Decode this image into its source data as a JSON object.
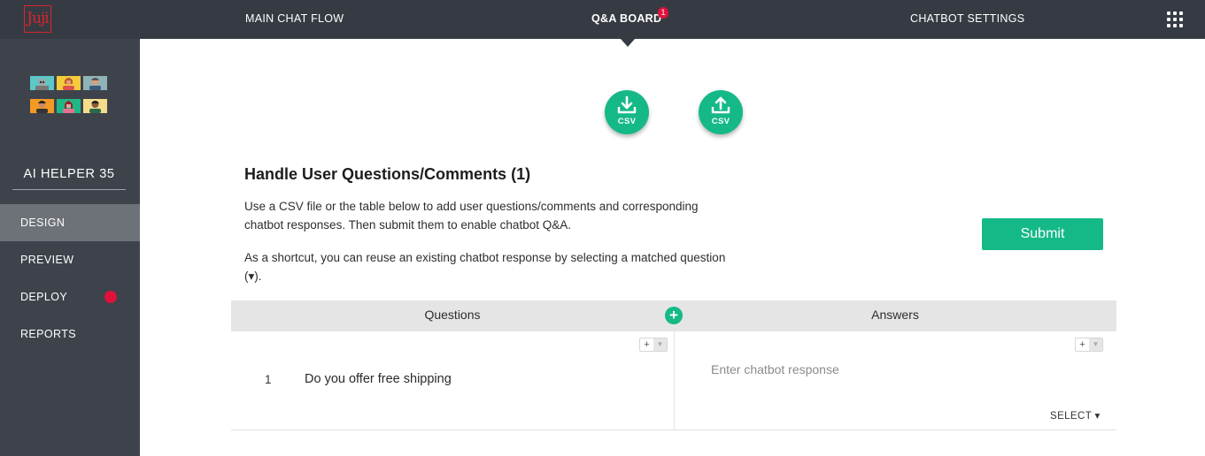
{
  "logo": {
    "text": "Juji"
  },
  "nav": {
    "items": [
      {
        "label": "MAIN CHAT FLOW"
      },
      {
        "label": "Q&A BOARD",
        "badge": "1"
      },
      {
        "label": "CHATBOT SETTINGS"
      }
    ],
    "active": "Q&A BOARD"
  },
  "sidebar": {
    "bot_name": "AI HELPER 35",
    "items": [
      {
        "label": "DESIGN",
        "active": true
      },
      {
        "label": "PREVIEW"
      },
      {
        "label": "DEPLOY",
        "status_dot": "red"
      },
      {
        "label": "REPORTS"
      }
    ]
  },
  "csv": {
    "download_label": "CSV",
    "upload_label": "CSV"
  },
  "main": {
    "title": "Handle User Questions/Comments (1)",
    "para1": "Use a CSV file or the table below to add user questions/comments and corresponding chatbot responses. Then submit them to enable chatbot Q&A.",
    "para2": "As a shortcut, you can reuse an existing chatbot response by selecting a matched question (▾).",
    "submit_label": "Submit"
  },
  "table": {
    "headers": {
      "questions": "Questions",
      "answers": "Answers"
    },
    "add_symbol": "+",
    "rows": [
      {
        "number": "1",
        "question": "Do you offer free shipping",
        "answer_value": "",
        "answer_placeholder": "Enter chatbot response",
        "select_label": "SELECT ▾"
      }
    ]
  },
  "colors": {
    "topbar": "#363b43",
    "sidebar": "#3e434b",
    "accent": "#15b987",
    "badge": "#e0113b"
  }
}
